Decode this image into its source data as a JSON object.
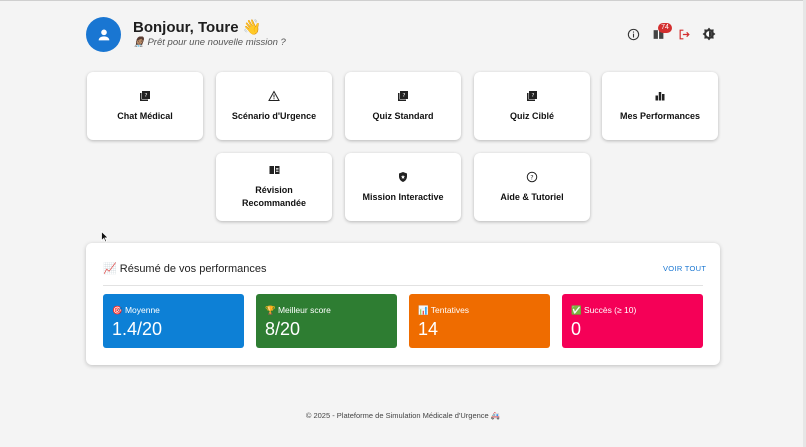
{
  "header": {
    "greeting": "Bonjour, Toure 👋",
    "subtitle": "👩🏽‍⚕️ Prêt pour une nouvelle mission ?",
    "notification_count": "74",
    "icons": [
      "info-icon",
      "notifications-book-icon",
      "logout-icon",
      "theme-toggle-icon"
    ]
  },
  "cards": [
    {
      "label": "Chat Médical",
      "icon": "quiz-book-icon"
    },
    {
      "label": "Scénario d'Urgence",
      "icon": "warning-icon"
    },
    {
      "label": "Quiz Standard",
      "icon": "quiz-book-icon"
    },
    {
      "label": "Quiz Ciblé",
      "icon": "quiz-book-icon"
    },
    {
      "label": "Mes Performances",
      "icon": "bar-chart-icon"
    },
    {
      "label": "Révision Recommandée",
      "icon": "open-book-icon"
    },
    {
      "label": "Mission Interactive",
      "icon": "shield-icon"
    },
    {
      "label": "Aide & Tutoriel",
      "icon": "help-circle-icon"
    }
  ],
  "summary": {
    "title": "📈 Résumé de vos performances",
    "voir_tout": "VOIR TOUT",
    "stats": [
      {
        "label": "🎯 Moyenne",
        "value": "1.4/20",
        "color": "#0d80d6"
      },
      {
        "label": "🏆 Meilleur score",
        "value": "8/20",
        "color": "#2e7d32"
      },
      {
        "label": "📊 Tentatives",
        "value": "14",
        "color": "#ef6c00"
      },
      {
        "label": "✅ Succès (≥ 10)",
        "value": "0",
        "color": "#f50057"
      }
    ]
  },
  "footer": "© 2025 - Plateforme de Simulation Médicale d'Urgence 🚑"
}
